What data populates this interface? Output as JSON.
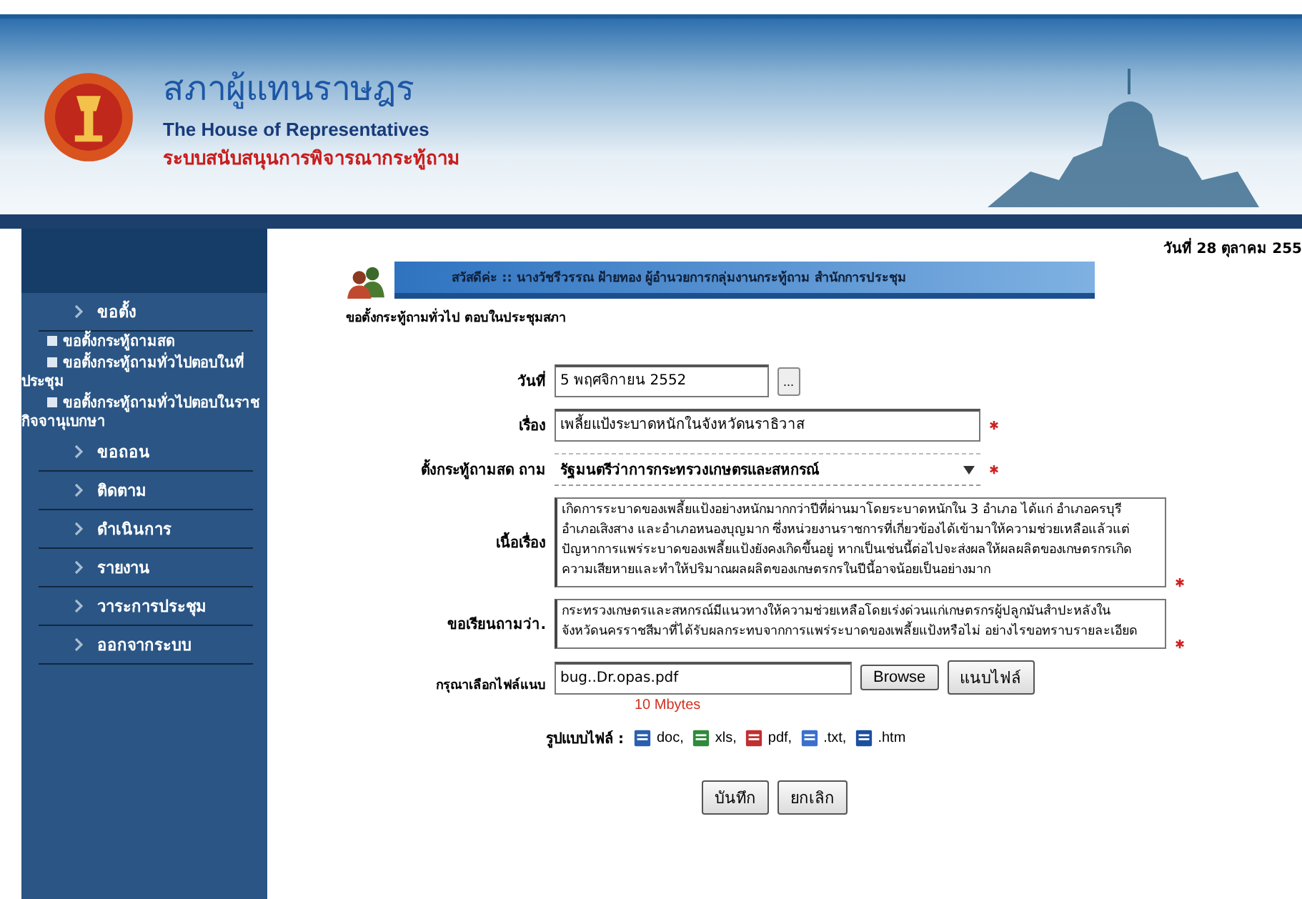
{
  "header": {
    "title_thai": "สภาผู้แทนราษฎร",
    "title_english": "The House of Representatives",
    "system_name": "ระบบสนับสนุนการพิจารณากระทู้ถาม"
  },
  "sidebar": {
    "items": [
      {
        "kind": "main",
        "label": "ขอตั้ง"
      },
      {
        "kind": "sub",
        "label": "ขอตั้งกระทู้ถามสด"
      },
      {
        "kind": "sub",
        "label": "ขอตั้งกระทู้ถามทั่วไปตอบในที่ประชุม"
      },
      {
        "kind": "sub",
        "label": "ขอตั้งกระทู้ถามทั่วไปตอบในราชกิจจานุเบกษา"
      },
      {
        "kind": "main",
        "label": "ขอถอน"
      },
      {
        "kind": "main",
        "label": "ติดตาม"
      },
      {
        "kind": "main",
        "label": "ดำเนินการ"
      },
      {
        "kind": "main",
        "label": "รายงาน"
      },
      {
        "kind": "main",
        "label": "วาระการประชุม"
      },
      {
        "kind": "main",
        "label": "ออกจากระบบ"
      }
    ]
  },
  "date_line": "วันที่ 28 ตุลาคม 255",
  "greeting": "สวัสดีค่ะ :: นางวัชรีวรรณ ฝ้ายทอง ผู้อำนวยการกลุ่มงานกระทู้ถาม สำนักการประชุม",
  "page_title": "ขอตั้งกระทู้ถามทั่วไป ตอบในประชุมสภา",
  "form": {
    "date": {
      "label": "วันที่",
      "value": "5 พฤศจิกายน 2552",
      "button": "..."
    },
    "subject": {
      "label": "เรื่อง",
      "value": "เพลี้ยแป้งระบาดหนักในจังหวัดนราธิวาส",
      "required": true
    },
    "addressee": {
      "label": "ตั้งกระทู้ถามสด ถาม",
      "value": "รัฐมนตรีว่าการกระทรวงเกษตรและสหกรณ์",
      "required": true
    },
    "body": {
      "label": "เนื้อเรื่อง",
      "value": "เกิดการระบาดของเพลี้ยแป้งอย่างหนักมากกว่าปีที่ผ่านมาโดยระบาดหนักใน 3 อำเภอ ได้แก่ อำเภอครบุรี อำเภอเสิงสาง และอำเภอหนองบุญมาก ซึ่งหน่วยงานราชการที่เกี่ยวข้องได้เข้ามาให้ความช่วยเหลือแล้วแต่ปัญหาการแพร่ระบาดของเพลี้ยแป้งยังคงเกิดขึ้นอยู่ หากเป็นเช่นนี้ต่อไปจะส่งผลให้ผลผลิตของเกษตรกรเกิดความเสียหายและทำให้ปริมาณผลผลิตของเกษตรกรในปีนี้อาจน้อยเป็นอย่างมาก",
      "required": true
    },
    "question": {
      "label": "ขอเรียนถามว่า.",
      "value": "กระทรวงเกษตรและสหกรณ์มีแนวทางให้ความช่วยเหลือโดยเร่งด่วนแก่เกษตรกรผู้ปลูกมันสำปะหลังในจังหวัดนครราชสีมาที่ได้รับผลกระทบจากการแพร่ระบาดของเพลี้ยแป้งหรือไม่ อย่างไรขอทราบรายละเอียด",
      "required": true
    },
    "attachment": {
      "label": "กรุณาเลือกไฟล์แนบ",
      "value": "bug..Dr.opas.pdf",
      "browse_button": "Browse",
      "attach_button": "แนบไฟล์",
      "size_limit": "10 Mbytes"
    },
    "file_types": {
      "label": "รูปแบบไฟล์ :",
      "types": [
        {
          "kind": "doc",
          "label": "doc,"
        },
        {
          "kind": "xls",
          "label": "xls,"
        },
        {
          "kind": "pdf",
          "label": "pdf,"
        },
        {
          "kind": "txt",
          "label": ".txt,"
        },
        {
          "kind": "htm",
          "label": ".htm"
        }
      ]
    },
    "buttons": [
      "บันทึก",
      "ยกเลิก"
    ]
  }
}
